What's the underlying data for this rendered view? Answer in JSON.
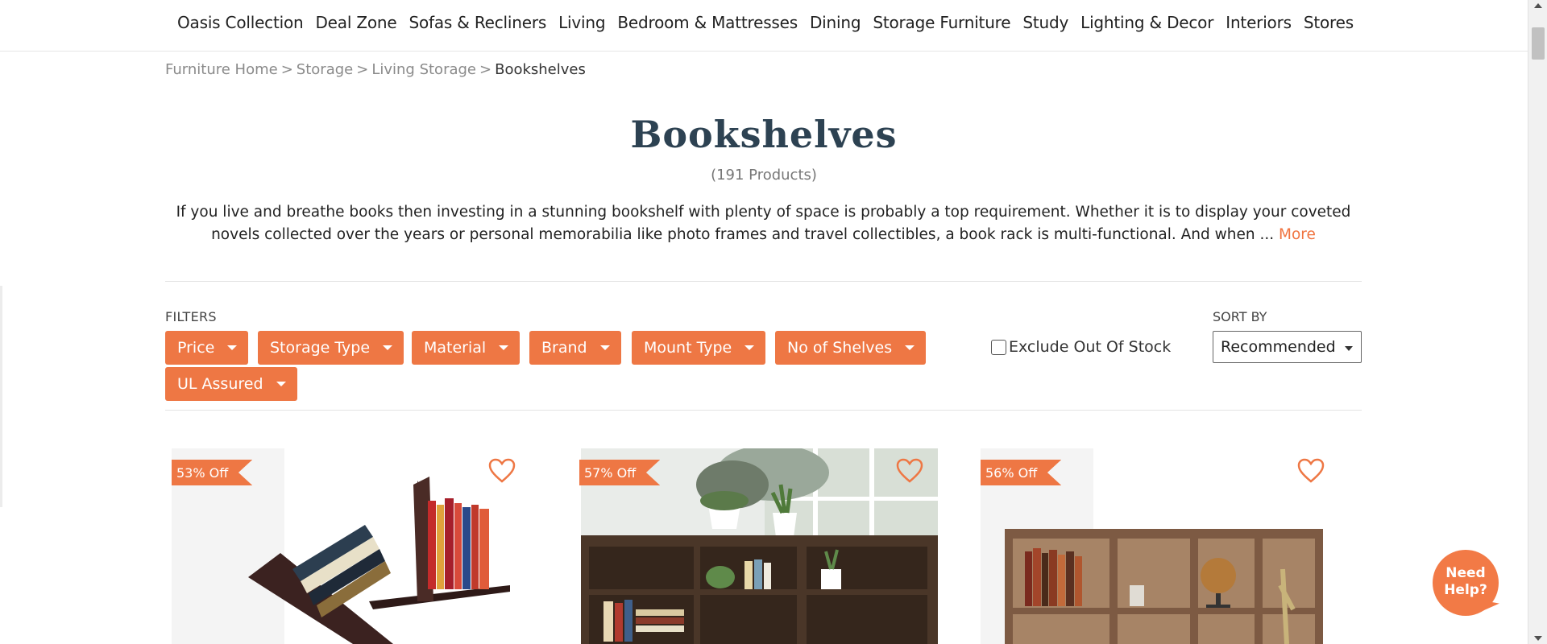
{
  "nav": {
    "items": [
      "Oasis Collection",
      "Deal Zone",
      "Sofas & Recliners",
      "Living",
      "Bedroom & Mattresses",
      "Dining",
      "Storage Furniture",
      "Study",
      "Lighting & Decor",
      "Interiors",
      "Stores"
    ]
  },
  "breadcrumb": {
    "items": [
      "Furniture Home",
      "Storage",
      "Living Storage"
    ],
    "separator": ">",
    "current": "Bookshelves"
  },
  "page": {
    "title": "Bookshelves",
    "count": "(191 Products)",
    "description": "If you live and breathe books then investing in a stunning bookshelf with plenty of space is probably a top requirement. Whether it is to display your coveted novels collected over the years or personal memorabilia like photo frames and travel collectibles, a book rack is multi-functional. And when ... ",
    "more_label": "More"
  },
  "filters": {
    "label": "FILTERS",
    "buttons": [
      "Price",
      "Storage Type",
      "Material",
      "Brand",
      "Mount Type",
      "No of Shelves",
      "UL Assured"
    ],
    "exclude_out_of_stock": "Exclude Out Of Stock",
    "exclude_checked": false
  },
  "sort": {
    "label": "SORT BY",
    "selected": "Recommended"
  },
  "products": [
    {
      "badge": "53% Off",
      "icon": "heart-outline-icon"
    },
    {
      "badge": "57% Off",
      "icon": "heart-outline-icon"
    },
    {
      "badge": "56% Off",
      "icon": "heart-outline-icon"
    }
  ],
  "help": {
    "line1": "Need",
    "line2": "Help?"
  },
  "colors": {
    "accent": "#ee7744",
    "title": "#2d4252"
  }
}
